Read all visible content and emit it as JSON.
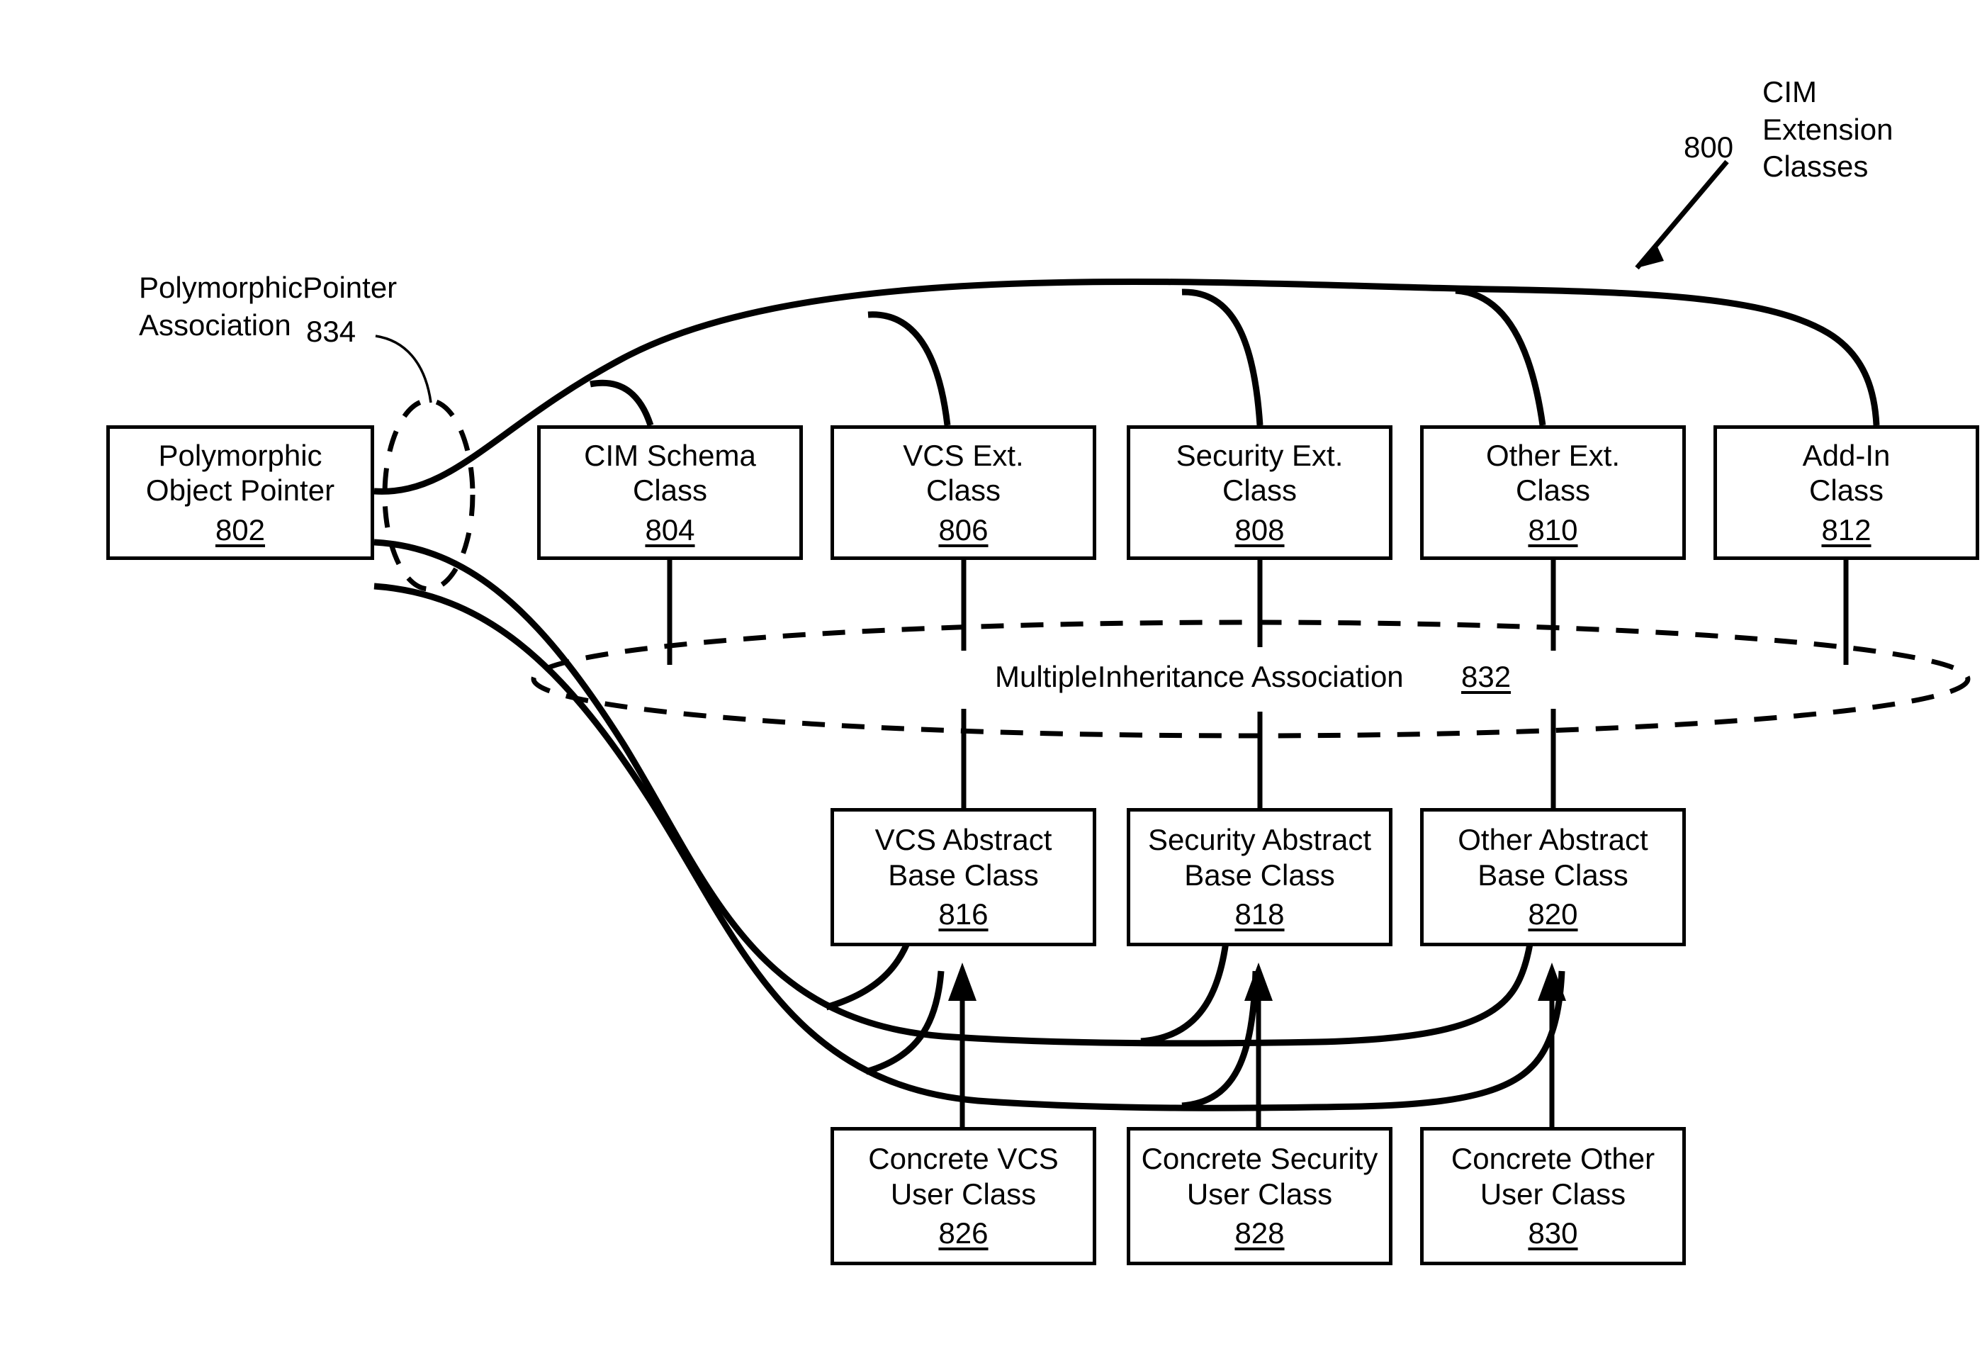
{
  "figure": {
    "title_label": "CIM\nExtension\nClasses",
    "title_ref": "800"
  },
  "annotations": {
    "polymorphic_pointer_association": {
      "label": "PolymorphicPointer\nAssociation",
      "ref": "834"
    },
    "multiple_inheritance_association": {
      "label": "MultipleInheritance Association",
      "ref": "832"
    }
  },
  "nodes": {
    "pointer": {
      "line1": "Polymorphic",
      "line2": "Object Pointer",
      "ref": "802"
    },
    "extension_classes": [
      {
        "line1": "CIM Schema",
        "line2": "Class",
        "ref": "804"
      },
      {
        "line1": "VCS Ext.",
        "line2": "Class",
        "ref": "806"
      },
      {
        "line1": "Security Ext.",
        "line2": "Class",
        "ref": "808"
      },
      {
        "line1": "Other Ext.",
        "line2": "Class",
        "ref": "810"
      },
      {
        "line1": "Add-In",
        "line2": "Class",
        "ref": "812"
      }
    ],
    "abstract_base_classes": [
      {
        "line1": "VCS Abstract",
        "line2": "Base Class",
        "ref": "816"
      },
      {
        "line1": "Security Abstract",
        "line2": "Base Class",
        "ref": "818"
      },
      {
        "line1": "Other Abstract",
        "line2": "Base Class",
        "ref": "820"
      }
    ],
    "concrete_user_classes": [
      {
        "line1": "Concrete VCS",
        "line2": "User Class",
        "ref": "826"
      },
      {
        "line1": "Concrete Security",
        "line2": "User Class",
        "ref": "828"
      },
      {
        "line1": "Concrete Other",
        "line2": "User Class",
        "ref": "830"
      }
    ]
  },
  "style": {
    "stroke": "#000000",
    "background": "#ffffff"
  }
}
